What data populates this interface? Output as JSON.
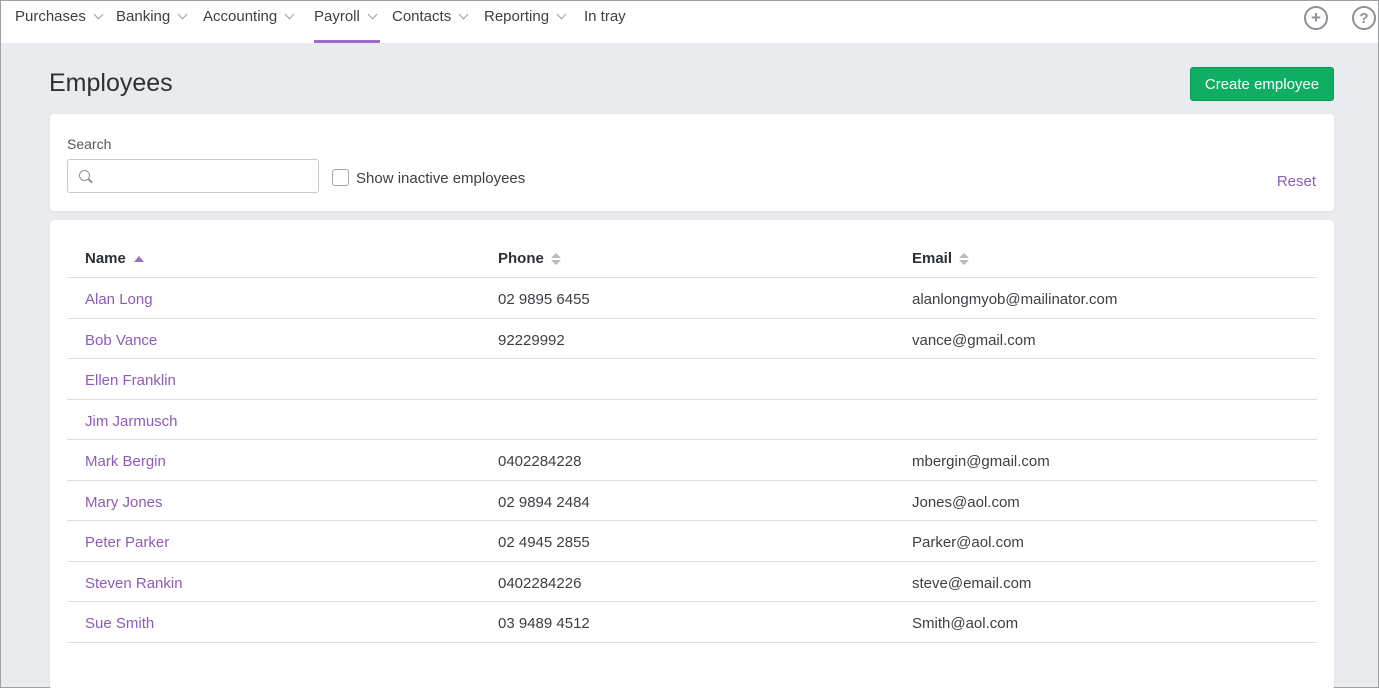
{
  "nav": {
    "items": [
      {
        "label": "Purchases",
        "has_dropdown": true
      },
      {
        "label": "Banking",
        "has_dropdown": true
      },
      {
        "label": "Accounting",
        "has_dropdown": true
      },
      {
        "label": "Payroll",
        "has_dropdown": true,
        "active": true
      },
      {
        "label": "Contacts",
        "has_dropdown": true
      },
      {
        "label": "Reporting",
        "has_dropdown": true
      },
      {
        "label": "In tray",
        "has_dropdown": false
      }
    ],
    "add_icon": "plus-circle-icon",
    "help_icon": "help-circle-icon",
    "active_color": "#9f6bc9"
  },
  "page": {
    "title": "Employees",
    "create_button": "Create employee",
    "create_button_color": "#0fae62"
  },
  "filters": {
    "search_label": "Search",
    "search_value": "",
    "show_inactive_label": "Show inactive employees",
    "show_inactive_checked": false,
    "reset_label": "Reset"
  },
  "table": {
    "columns": [
      {
        "label": "Name",
        "sort": "asc"
      },
      {
        "label": "Phone",
        "sort": "none"
      },
      {
        "label": "Email",
        "sort": "none"
      }
    ],
    "rows": [
      {
        "name": "Alan Long",
        "phone": "02 9895 6455",
        "email": "alanlongmyob@mailinator.com"
      },
      {
        "name": "Bob Vance",
        "phone": "92229992",
        "email": "vance@gmail.com"
      },
      {
        "name": "Ellen Franklin",
        "phone": "",
        "email": ""
      },
      {
        "name": "Jim Jarmusch",
        "phone": "",
        "email": ""
      },
      {
        "name": "Mark Bergin",
        "phone": "0402284228",
        "email": "mbergin@gmail.com"
      },
      {
        "name": "Mary Jones",
        "phone": "02 9894 2484",
        "email": "Jones@aol.com"
      },
      {
        "name": "Peter Parker",
        "phone": "02 4945 2855",
        "email": "Parker@aol.com"
      },
      {
        "name": "Steven Rankin",
        "phone": "0402284226",
        "email": "steve@email.com"
      },
      {
        "name": "Sue Smith",
        "phone": "03 9489 4512",
        "email": "Smith@aol.com"
      }
    ],
    "link_color": "#8e5cb5"
  }
}
